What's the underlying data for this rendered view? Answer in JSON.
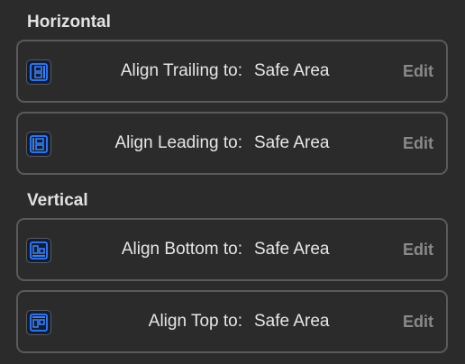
{
  "sections": {
    "horizontal_title": "Horizontal",
    "vertical_title": "Vertical"
  },
  "rows": [
    {
      "label": "Align Trailing to:",
      "value": "Safe Area",
      "edit": "Edit",
      "icon": "align-trailing-icon"
    },
    {
      "label": "Align Leading to:",
      "value": "Safe Area",
      "edit": "Edit",
      "icon": "align-leading-icon"
    },
    {
      "label": "Align Bottom to:",
      "value": "Safe Area",
      "edit": "Edit",
      "icon": "align-bottom-icon"
    },
    {
      "label": "Align Top to:",
      "value": "Safe Area",
      "edit": "Edit",
      "icon": "align-top-icon"
    }
  ],
  "colors": {
    "accent": "#3c7df0",
    "background": "#2b2b2c",
    "border": "#5a5a5c",
    "edit_text": "#8a8a8c"
  }
}
